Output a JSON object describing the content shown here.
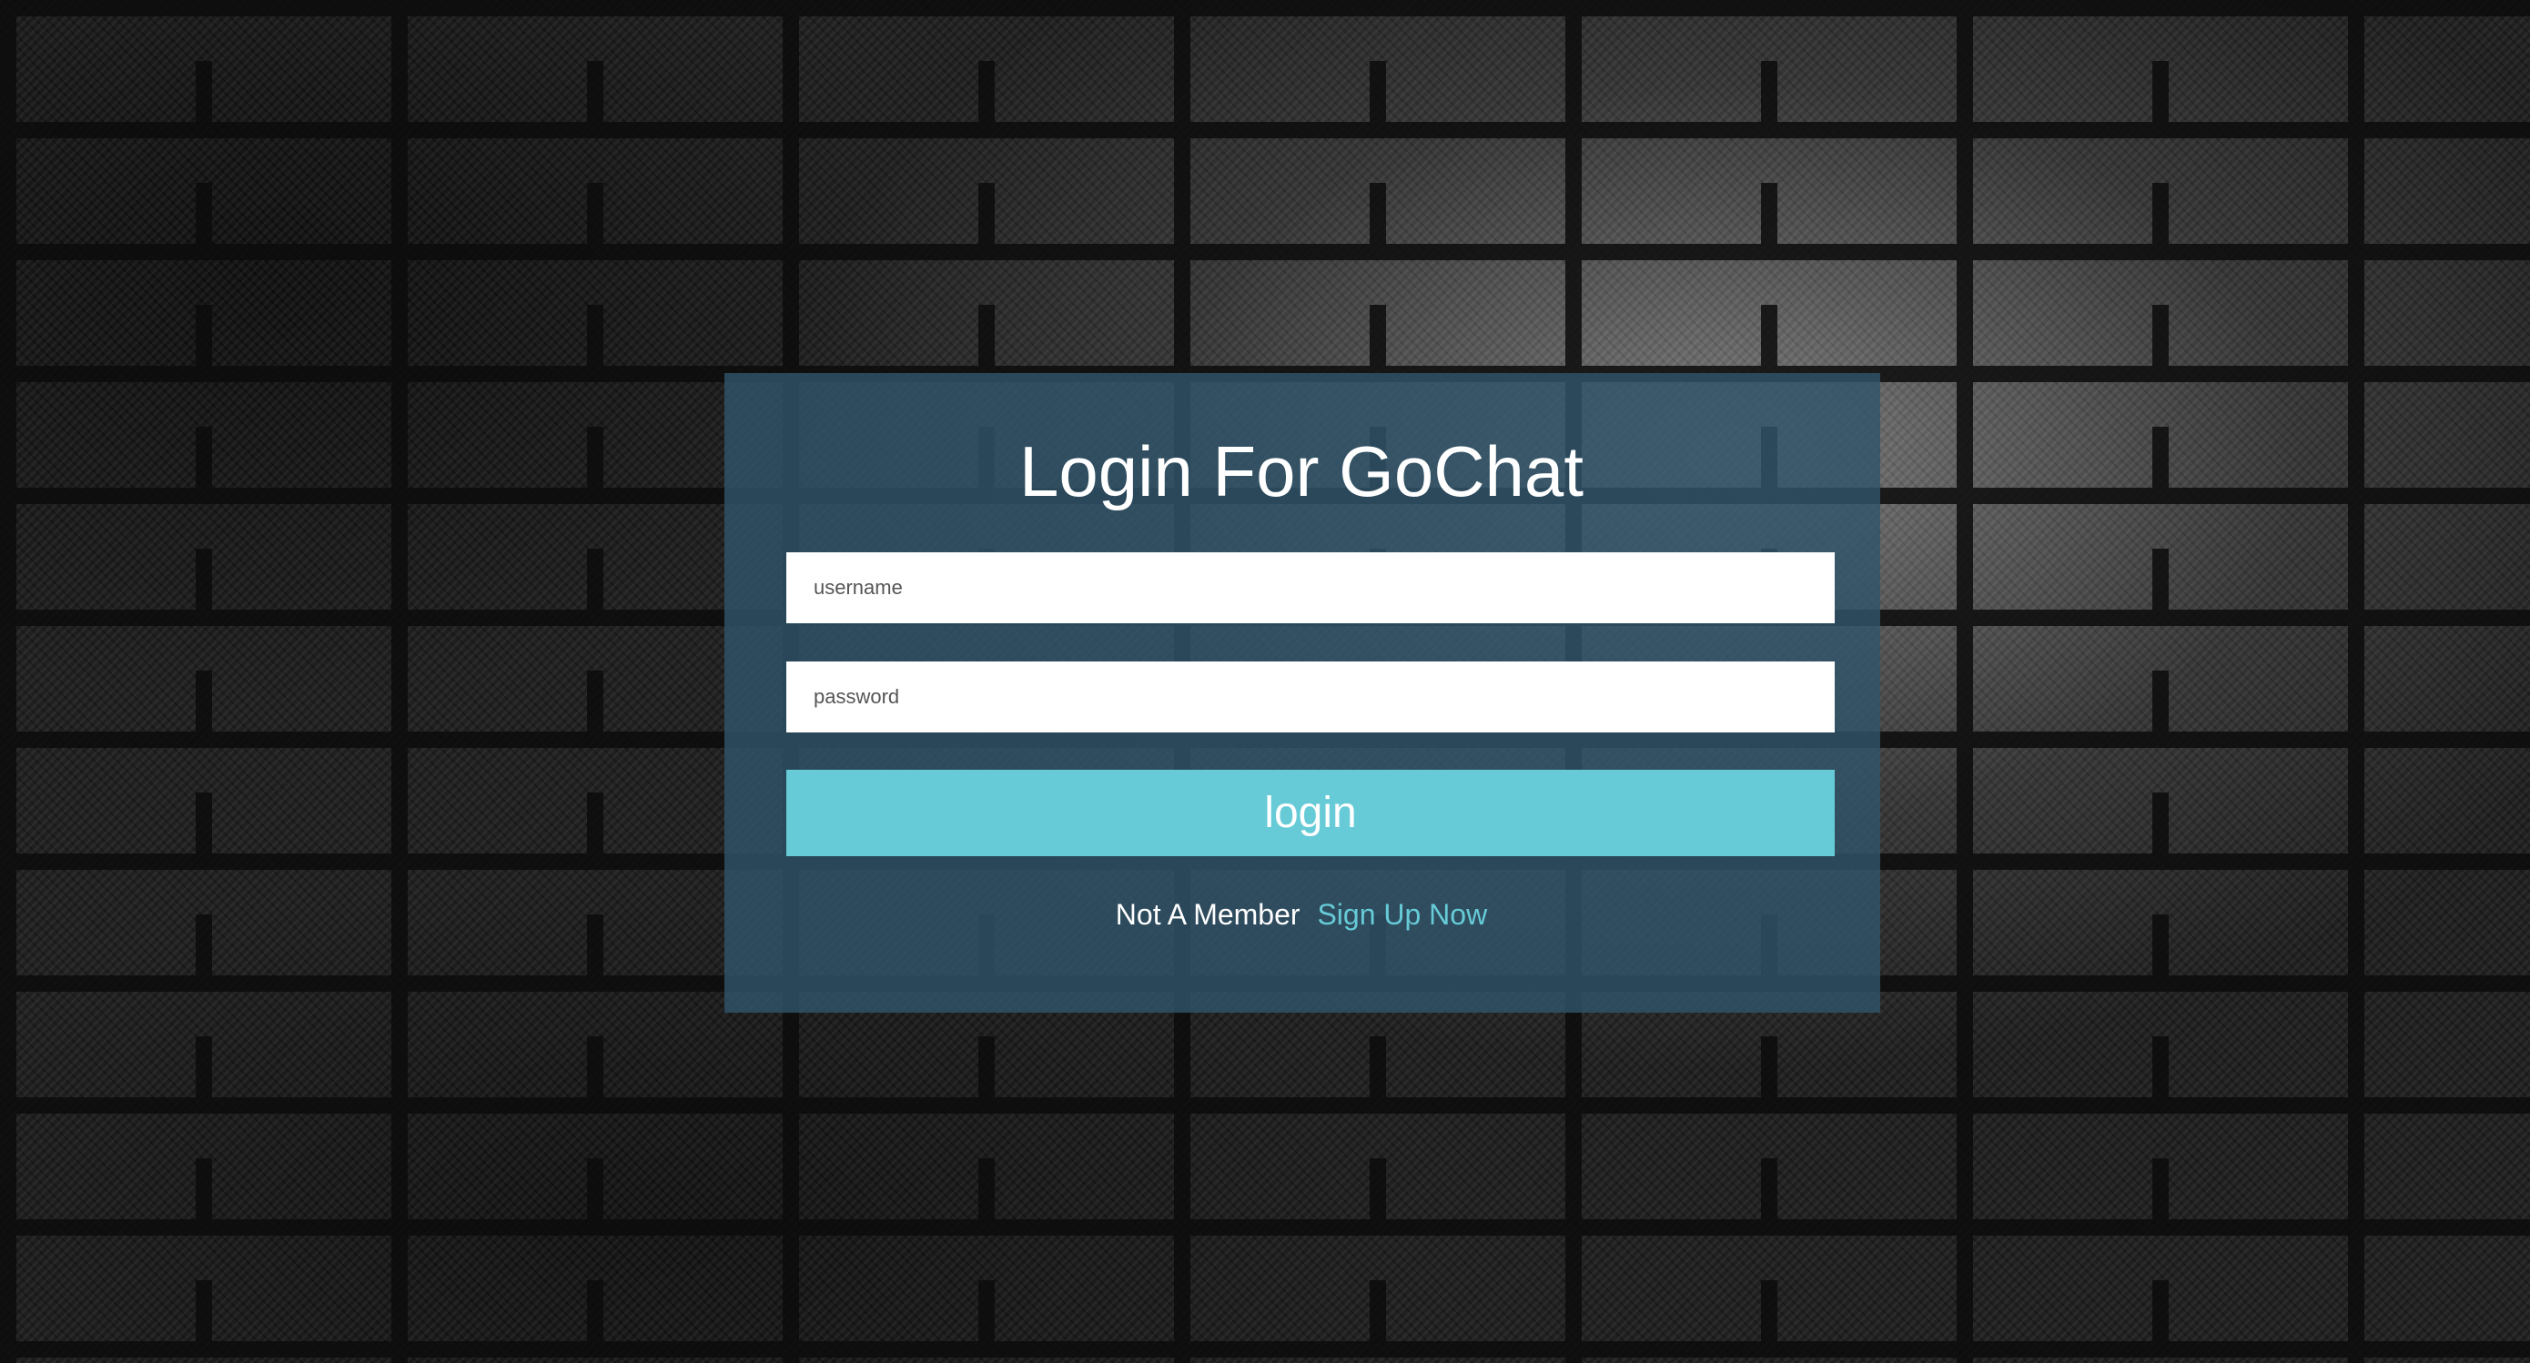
{
  "login": {
    "title": "Login For GoChat",
    "username_placeholder": "username",
    "password_placeholder": "password",
    "button_label": "login",
    "not_member_text": "Not A Member",
    "signup_link_text": "Sign Up Now"
  },
  "colors": {
    "panel": "#30546a",
    "accent": "#66cbd7",
    "text": "#ffffff"
  }
}
